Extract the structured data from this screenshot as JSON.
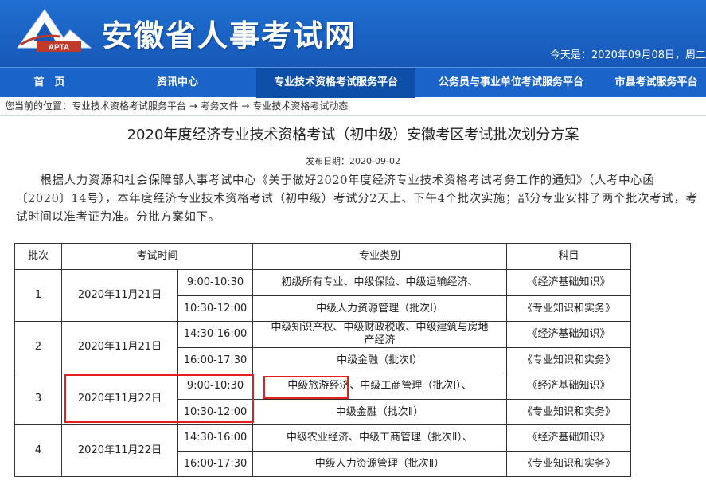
{
  "header": {
    "logo_text": "APTA",
    "site_title": "安徽省人事考试网",
    "date_line": "今天是：2020年09月08日，周二"
  },
  "nav": [
    {
      "label": "首　页"
    },
    {
      "label": "资讯中心"
    },
    {
      "label": "专业技术资格考试服务平台",
      "active": true
    },
    {
      "label": "公务员与事业单位考试服务平台"
    },
    {
      "label": "市县考试服务平台"
    }
  ],
  "breadcrumb": "您当前的位置：专业技术资格考试服务平台 → 考务文件 → 专业技术资格考试动态",
  "article": {
    "title": "2020年度经济专业技术资格考试（初中级）安徽考区考试批次划分方案",
    "publish_date": "发布日期：2020-09-02",
    "intro": "根据人力资源和社会保障部人事考试中心《关于做好2020年度经济专业技术资格考试考务工作的通知》（人考中心函〔2020〕14号），本年度经济专业技术资格考试（初中级）考试分2天上、下午4个批次实施；部分专业安排了两个批次考试，考试时间以准考证为准。分批方案如下。"
  },
  "table": {
    "headers": {
      "batch": "批次",
      "time": "考试时间",
      "major": "专业类别",
      "subject": "科目"
    },
    "batches": [
      {
        "no": "1",
        "date": "2020年11月21日",
        "slots": [
          "9:00-10:30",
          "10:30-12:00"
        ],
        "majors": [
          "初级所有专业、中级保险、中级运输经济、",
          "中级人力资源管理（批次Ⅰ）"
        ],
        "subjects": [
          "《经济基础知识》",
          "《专业知识和实务》"
        ]
      },
      {
        "no": "2",
        "date": "2020年11月21日",
        "slots": [
          "14:30-16:00",
          "16:00-17:30"
        ],
        "majors": [
          "中级知识产权、中级财政税收、中级建筑与房地产经济",
          "中级金融（批次Ⅰ）"
        ],
        "subjects": [
          "《经济基础知识》",
          "《专业知识和实务》"
        ]
      },
      {
        "no": "3",
        "date": "2020年11月22日",
        "slots": [
          "9:00-10:30",
          "10:30-12:00"
        ],
        "majors_hl": "中级旅游经济、",
        "majors_rest": "中级工商管理（批次Ⅰ）、",
        "majors": [
          "",
          "中级金融（批次Ⅱ）"
        ],
        "subjects": [
          "《经济基础知识》",
          "《专业知识和实务》"
        ]
      },
      {
        "no": "4",
        "date": "2020年11月22日",
        "slots": [
          "14:30-16:00",
          "16:00-17:30"
        ],
        "majors": [
          "中级农业经济、中级工商管理（批次Ⅱ）、",
          "中级人力资源管理（批次Ⅱ）"
        ],
        "subjects": [
          "《经济基础知识》",
          "《专业知识和实务》"
        ]
      }
    ]
  },
  "colors": {
    "header_blue": "#1758b8",
    "nav_active": "#0d4ea8",
    "highlight_red": "#e3201b"
  }
}
